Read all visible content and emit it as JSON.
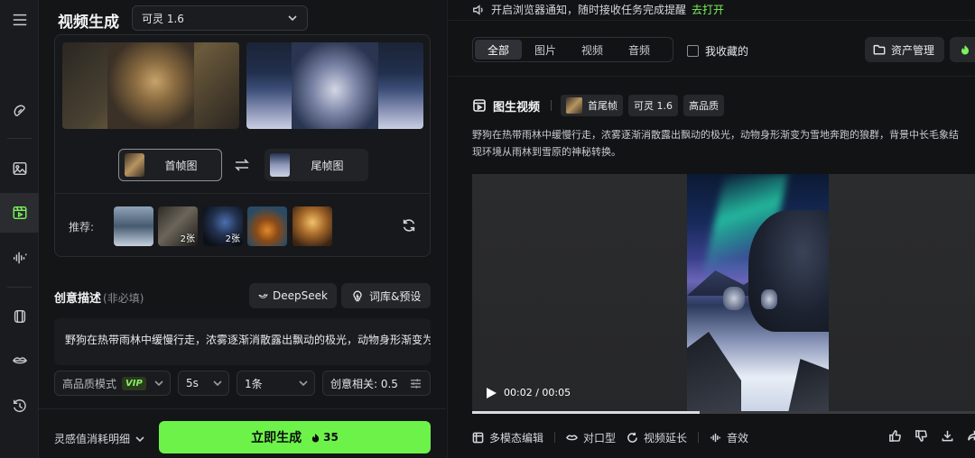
{
  "header": {
    "title": "视频生成",
    "model_selected": "可灵 1.6"
  },
  "frames": {
    "first_label": "首帧图",
    "last_label": "尾帧图"
  },
  "recommend": {
    "label": "推荐:",
    "items": [
      {
        "badge": ""
      },
      {
        "badge": "2张"
      },
      {
        "badge": "2张"
      },
      {
        "badge": ""
      },
      {
        "badge": ""
      }
    ]
  },
  "description": {
    "title": "创意描述",
    "optional": "(非必填)",
    "deepseek_label": "DeepSeek",
    "lexicon_label": "词库&预设",
    "text": "野狗在热带雨林中缓慢行走，浓雾逐渐消散露出飘动的极光，动物身形渐变为"
  },
  "options": {
    "quality_label": "高品质模式",
    "vip_badge": "VIP",
    "duration": "5s",
    "count": "1条",
    "relevance": "创意相关: 0.5"
  },
  "footer": {
    "cost_detail_label": "灵感值消耗明细",
    "generate_label": "立即生成",
    "generate_cost": "35"
  },
  "notification": {
    "text": "开启浏览器通知，随时接收任务完成提醒",
    "link": "去打开"
  },
  "filter_tabs": [
    {
      "label": "全部",
      "active": true
    },
    {
      "label": "图片",
      "active": false
    },
    {
      "label": "视频",
      "active": false
    },
    {
      "label": "音频",
      "active": false
    }
  ],
  "favorites_label": "我收藏的",
  "asset_button_label": "资产管理",
  "task": {
    "type": "图生视频",
    "tags": [
      "首尾帧",
      "可灵 1.6",
      "高品质"
    ],
    "prompt_line1": "野狗在热带雨林中缓慢行走，浓雾逐渐消散露出飘动的极光，动物身形渐变为雪地奔跑的狼群，背景中长毛象结",
    "prompt_line2": "现环境从雨林到雪原的神秘转换。"
  },
  "player": {
    "time": "00:02 / 00:05",
    "progress": 0.45
  },
  "result_actions": [
    "多模态编辑",
    "对口型",
    "视频延长",
    "音效"
  ],
  "colors": {
    "accent": "#6df24a",
    "background": "#121315",
    "panel": "#141517"
  }
}
